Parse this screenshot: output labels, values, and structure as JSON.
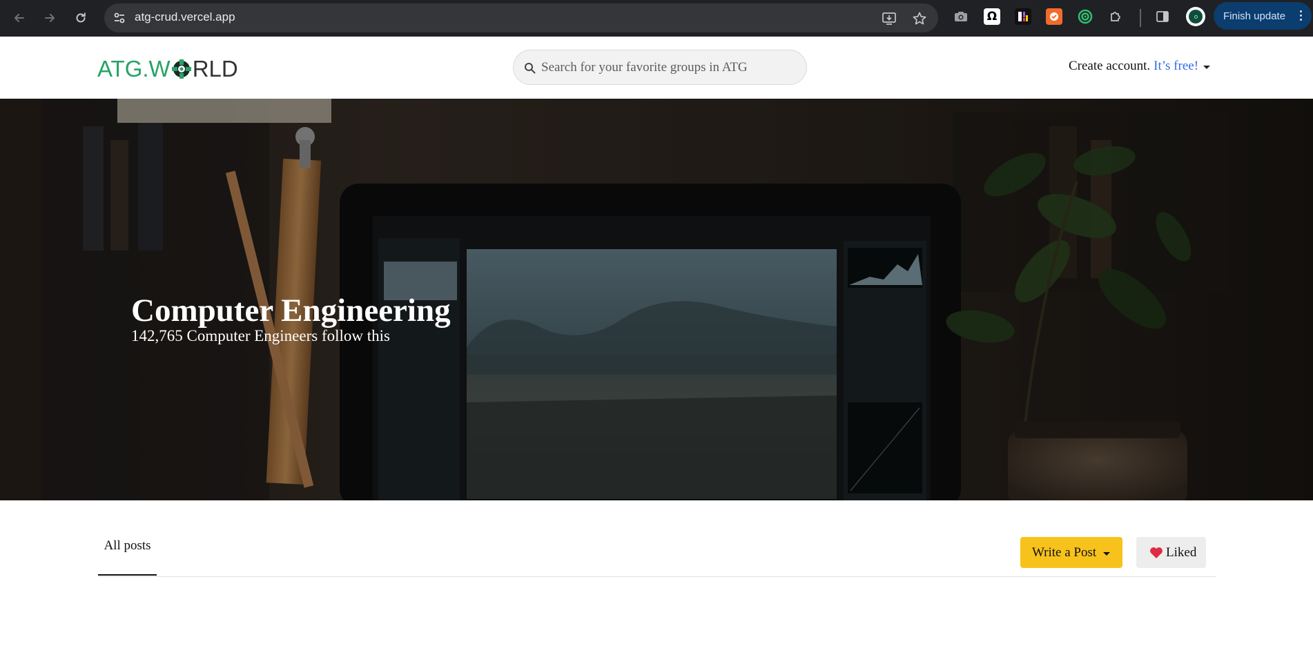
{
  "browser": {
    "url": "atg-crud.vercel.app",
    "finish_update_label": "Finish update",
    "icons": {
      "back": "arrow-left-icon",
      "forward": "arrow-right-icon",
      "reload": "reload-icon",
      "site_info": "tune-icon",
      "install": "install-app-icon",
      "bookmark": "star-icon",
      "extensions": [
        "camera-icon",
        "omega-icon",
        "notion-like-icon",
        "orange-extension-icon",
        "target-icon",
        "puzzle-icon"
      ],
      "side_panel": "side-panel-icon",
      "menu": "kebab-menu-icon"
    },
    "colors": {
      "chrome_bg": "#202124",
      "omnibox_bg": "#35363a",
      "update_bg": "#0b3d6e"
    }
  },
  "header": {
    "logo": {
      "part1": "ATG.W",
      "part2": "RLD"
    },
    "search_placeholder": "Search for your favorite groups in ATG",
    "create_account": "Create account.",
    "free": "It’s free!"
  },
  "hero": {
    "title": "Computer Engineering",
    "subtitle": "142,765 Computer Engineers follow this"
  },
  "tabs": {
    "all_posts": "All posts"
  },
  "actions": {
    "write_post": "Write a Post",
    "liked": "Liked"
  },
  "colors": {
    "brand_green": "#27a365",
    "link_blue": "#2f6ce5",
    "write_post_yellow": "#f7c21b",
    "liked_bg": "#ededed",
    "heart": "#e02a43"
  }
}
